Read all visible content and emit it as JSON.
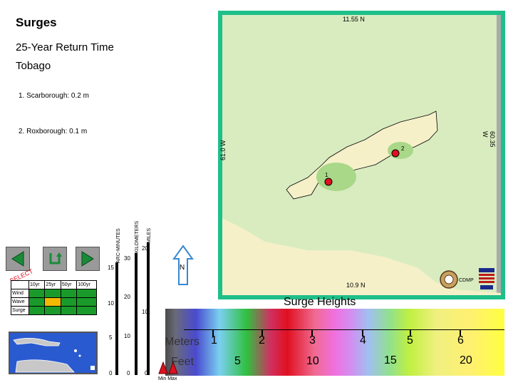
{
  "header": {
    "title": "Surges",
    "return_time": "25-Year Return Time",
    "region": "Tobago"
  },
  "locations": [
    {
      "label": "1. Scarborough:  0.2 m"
    },
    {
      "label": "2. Roxborough:  0.1 m"
    }
  ],
  "map": {
    "lat_top": "11.55 N",
    "lat_bottom": "10.9 N",
    "lon_left": "61.0 W",
    "lon_right": "60.35 W",
    "markers": [
      "1",
      "2"
    ],
    "north": "N",
    "credit": "CDMP",
    "colors": {
      "frame": "#1fbf8a",
      "land": "#f5f0c8",
      "sea": "#d8ecc0",
      "marker": "#e01020"
    }
  },
  "scales": {
    "arc_label": "ARC-MINUTES",
    "km_label": "KILOMETERS",
    "miles_label": "MILES",
    "arc_ticks": [
      "15",
      "10",
      "5",
      "0"
    ],
    "km_ticks": [
      "30",
      "20",
      "10",
      "0"
    ],
    "miles_ticks": [
      "20",
      "10",
      "0"
    ]
  },
  "selector": {
    "select_label": "SELECT",
    "columns": [
      "10yr",
      "25yr",
      "50yr",
      "100yr"
    ],
    "rows": [
      "Wind",
      "Wave",
      "Surge"
    ],
    "selected": {
      "row": "Wave",
      "column": "25yr"
    }
  },
  "legend": {
    "title": "Surge Heights",
    "meters_label": "Meters",
    "feet_label": "Feet",
    "meter_ticks": [
      "1",
      "2",
      "3",
      "4",
      "5",
      "6"
    ],
    "feet_ticks": [
      "5",
      "10",
      "15",
      "20"
    ],
    "minmax_label": "Min Max"
  },
  "nav": {
    "back_icon": "left-arrow-icon",
    "home_icon": "return-arrow-icon",
    "forward_icon": "right-arrow-icon"
  }
}
